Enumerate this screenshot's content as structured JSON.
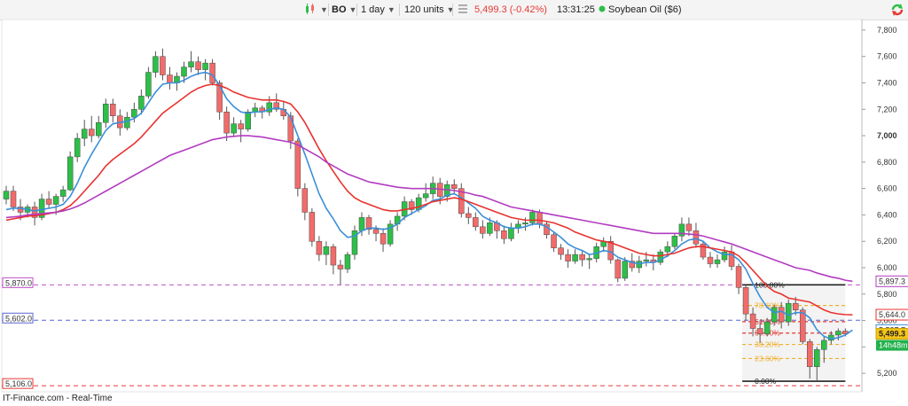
{
  "toolbar": {
    "symbol": "BO",
    "interval": "1 day",
    "units": "120 units",
    "last_price": "5,499.3",
    "change": "(-0.42%)",
    "time": "13:31:25",
    "instrument": "Soybean Oil ($6)"
  },
  "footer": {
    "text": "IT-Finance.com - Real-Time"
  },
  "colors": {
    "bull": "#2dbf47",
    "bear": "#f26b6b",
    "ma_fast": "#3a8fd9",
    "ma_mid": "#e8322e",
    "ma_slow": "#b23cc0",
    "hline_magenta": "#c050c8",
    "hline_blue": "#5a66d0",
    "hline_red": "#e53935"
  },
  "chart_data": {
    "type": "candlestick",
    "title": "",
    "xlabel": "",
    "ylabel": "",
    "ylim": [
      5060,
      7880
    ],
    "y_ticks": [
      5200,
      5400,
      5600,
      5800,
      6000,
      6200,
      6400,
      6600,
      6800,
      7000,
      7200,
      7400,
      7600,
      7800
    ],
    "y_tick_labels": [
      "5,200",
      "5,400",
      "5,600",
      "5,800",
      "6,000",
      "6,200",
      "6,400",
      "6,600",
      "6,800",
      "7,000",
      "7,200",
      "7,400",
      "7,600",
      "7,800"
    ],
    "ohlc": [
      [
        6520,
        6620,
        6480,
        6580
      ],
      [
        6580,
        6620,
        6430,
        6460
      ],
      [
        6460,
        6520,
        6360,
        6420
      ],
      [
        6420,
        6480,
        6380,
        6460
      ],
      [
        6460,
        6500,
        6320,
        6380
      ],
      [
        6380,
        6560,
        6360,
        6520
      ],
      [
        6520,
        6580,
        6450,
        6480
      ],
      [
        6480,
        6560,
        6400,
        6540
      ],
      [
        6540,
        6620,
        6500,
        6590
      ],
      [
        6590,
        6880,
        6580,
        6840
      ],
      [
        6840,
        7020,
        6800,
        6980
      ],
      [
        6980,
        7120,
        6920,
        7050
      ],
      [
        7050,
        7150,
        6950,
        7000
      ],
      [
        7000,
        7150,
        6980,
        7100
      ],
      [
        7100,
        7280,
        7060,
        7240
      ],
      [
        7240,
        7280,
        7100,
        7150
      ],
      [
        7150,
        7200,
        7000,
        7060
      ],
      [
        7060,
        7180,
        7040,
        7140
      ],
      [
        7140,
        7250,
        7100,
        7200
      ],
      [
        7200,
        7350,
        7160,
        7300
      ],
      [
        7300,
        7520,
        7280,
        7480
      ],
      [
        7480,
        7640,
        7440,
        7600
      ],
      [
        7600,
        7660,
        7420,
        7460
      ],
      [
        7460,
        7520,
        7350,
        7400
      ],
      [
        7400,
        7480,
        7340,
        7450
      ],
      [
        7450,
        7560,
        7400,
        7520
      ],
      [
        7520,
        7640,
        7480,
        7560
      ],
      [
        7560,
        7600,
        7460,
        7500
      ],
      [
        7500,
        7580,
        7420,
        7550
      ],
      [
        7550,
        7580,
        7380,
        7400
      ],
      [
        7400,
        7420,
        7120,
        7180
      ],
      [
        7180,
        7220,
        6960,
        7020
      ],
      [
        7020,
        7140,
        6990,
        7090
      ],
      [
        7090,
        7120,
        6950,
        7050
      ],
      [
        7050,
        7200,
        7030,
        7180
      ],
      [
        7180,
        7250,
        7140,
        7210
      ],
      [
        7210,
        7230,
        7130,
        7180
      ],
      [
        7180,
        7300,
        7150,
        7250
      ],
      [
        7250,
        7320,
        7180,
        7200
      ],
      [
        7200,
        7260,
        7120,
        7150
      ],
      [
        7150,
        7180,
        6900,
        6960
      ],
      [
        6960,
        6980,
        6540,
        6600
      ],
      [
        6600,
        6640,
        6360,
        6420
      ],
      [
        6420,
        6450,
        6160,
        6200
      ],
      [
        6200,
        6240,
        6050,
        6100
      ],
      [
        6100,
        6200,
        6020,
        6160
      ],
      [
        6160,
        6180,
        5950,
        6020
      ],
      [
        6020,
        6060,
        5870,
        5990
      ],
      [
        5990,
        6120,
        5960,
        6100
      ],
      [
        6100,
        6320,
        6060,
        6280
      ],
      [
        6280,
        6420,
        6240,
        6380
      ],
      [
        6380,
        6400,
        6250,
        6290
      ],
      [
        6290,
        6320,
        6200,
        6260
      ],
      [
        6260,
        6300,
        6120,
        6180
      ],
      [
        6180,
        6360,
        6160,
        6330
      ],
      [
        6330,
        6420,
        6280,
        6390
      ],
      [
        6390,
        6540,
        6360,
        6500
      ],
      [
        6500,
        6520,
        6400,
        6440
      ],
      [
        6440,
        6560,
        6420,
        6530
      ],
      [
        6530,
        6640,
        6500,
        6560
      ],
      [
        6560,
        6690,
        6520,
        6640
      ],
      [
        6640,
        6680,
        6480,
        6540
      ],
      [
        6540,
        6660,
        6500,
        6630
      ],
      [
        6630,
        6670,
        6560,
        6600
      ],
      [
        6600,
        6640,
        6380,
        6410
      ],
      [
        6410,
        6460,
        6330,
        6380
      ],
      [
        6380,
        6420,
        6280,
        6310
      ],
      [
        6310,
        6360,
        6220,
        6260
      ],
      [
        6260,
        6380,
        6240,
        6340
      ],
      [
        6340,
        6360,
        6220,
        6280
      ],
      [
        6280,
        6320,
        6180,
        6220
      ],
      [
        6220,
        6340,
        6200,
        6300
      ],
      [
        6300,
        6360,
        6260,
        6330
      ],
      [
        6330,
        6380,
        6280,
        6340
      ],
      [
        6340,
        6440,
        6320,
        6420
      ],
      [
        6420,
        6440,
        6300,
        6330
      ],
      [
        6330,
        6350,
        6220,
        6250
      ],
      [
        6250,
        6270,
        6120,
        6150
      ],
      [
        6150,
        6180,
        6060,
        6100
      ],
      [
        6100,
        6140,
        6000,
        6050
      ],
      [
        6050,
        6140,
        6030,
        6100
      ],
      [
        6100,
        6130,
        6010,
        6060
      ],
      [
        6060,
        6100,
        5990,
        6070
      ],
      [
        6070,
        6190,
        6040,
        6160
      ],
      [
        6160,
        6230,
        6120,
        6200
      ],
      [
        6200,
        6240,
        6030,
        6060
      ],
      [
        6060,
        6070,
        5890,
        5920
      ],
      [
        5920,
        6080,
        5900,
        6050
      ],
      [
        6050,
        6110,
        5970,
        6000
      ],
      [
        6000,
        6090,
        5960,
        6050
      ],
      [
        6050,
        6120,
        6010,
        6060
      ],
      [
        6060,
        6100,
        5980,
        6040
      ],
      [
        6040,
        6140,
        6020,
        6120
      ],
      [
        6120,
        6200,
        6080,
        6160
      ],
      [
        6160,
        6260,
        6140,
        6240
      ],
      [
        6240,
        6380,
        6200,
        6330
      ],
      [
        6330,
        6380,
        6240,
        6280
      ],
      [
        6280,
        6340,
        6150,
        6180
      ],
      [
        6180,
        6200,
        6060,
        6080
      ],
      [
        6080,
        6120,
        6000,
        6030
      ],
      [
        6030,
        6100,
        6000,
        6060
      ],
      [
        6060,
        6160,
        6040,
        6120
      ],
      [
        6120,
        6170,
        5980,
        6010
      ],
      [
        6010,
        6030,
        5800,
        5850
      ],
      [
        5850,
        5870,
        5600,
        5650
      ],
      [
        5650,
        5700,
        5480,
        5540
      ],
      [
        5540,
        5600,
        5430,
        5500
      ],
      [
        5500,
        5620,
        5480,
        5590
      ],
      [
        5590,
        5720,
        5560,
        5700
      ],
      [
        5700,
        5740,
        5540,
        5590
      ],
      [
        5590,
        5760,
        5560,
        5730
      ],
      [
        5730,
        5780,
        5640,
        5680
      ],
      [
        5680,
        5700,
        5420,
        5440
      ],
      [
        5440,
        5460,
        5160,
        5250
      ],
      [
        5250,
        5400,
        5140,
        5380
      ],
      [
        5380,
        5480,
        5280,
        5450
      ],
      [
        5450,
        5520,
        5420,
        5490
      ],
      [
        5490,
        5540,
        5450,
        5520
      ],
      [
        5520,
        5540,
        5480,
        5499.3
      ]
    ],
    "moving_averages": [
      {
        "color_key": "ma_fast",
        "last_value": 5527.7,
        "values": [
          6440,
          6450,
          6450,
          6440,
          6430,
          6440,
          6450,
          6460,
          6480,
          6540,
          6640,
          6760,
          6860,
          6950,
          7040,
          7090,
          7100,
          7110,
          7130,
          7170,
          7250,
          7330,
          7390,
          7400,
          7400,
          7420,
          7450,
          7470,
          7480,
          7460,
          7380,
          7280,
          7220,
          7180,
          7170,
          7180,
          7180,
          7200,
          7210,
          7200,
          7140,
          7000,
          6860,
          6710,
          6560,
          6450,
          6370,
          6280,
          6230,
          6240,
          6280,
          6300,
          6300,
          6290,
          6300,
          6330,
          6380,
          6410,
          6440,
          6470,
          6510,
          6520,
          6550,
          6560,
          6530,
          6490,
          6450,
          6390,
          6360,
          6340,
          6310,
          6300,
          6300,
          6310,
          6330,
          6330,
          6310,
          6270,
          6230,
          6180,
          6150,
          6130,
          6100,
          6110,
          6130,
          6120,
          6080,
          6060,
          6040,
          6030,
          6040,
          6040,
          6060,
          6090,
          6130,
          6180,
          6210,
          6220,
          6200,
          6150,
          6120,
          6100,
          6100,
          6060,
          5990,
          5880,
          5780,
          5700,
          5660,
          5670,
          5640,
          5660,
          5660,
          5620,
          5530,
          5480,
          5460,
          5470,
          5490,
          5527.7
        ]
      },
      {
        "color_key": "ma_mid",
        "last_value": 5644.0,
        "values": [
          6360,
          6370,
          6380,
          6390,
          6395,
          6400,
          6410,
          6420,
          6440,
          6470,
          6520,
          6580,
          6640,
          6700,
          6770,
          6820,
          6860,
          6900,
          6940,
          6990,
          7050,
          7110,
          7170,
          7210,
          7250,
          7290,
          7330,
          7360,
          7380,
          7390,
          7380,
          7360,
          7330,
          7310,
          7290,
          7280,
          7270,
          7270,
          7270,
          7260,
          7240,
          7180,
          7100,
          7000,
          6900,
          6810,
          6730,
          6650,
          6580,
          6530,
          6500,
          6480,
          6460,
          6440,
          6430,
          6430,
          6440,
          6450,
          6460,
          6480,
          6500,
          6510,
          6520,
          6530,
          6520,
          6500,
          6480,
          6460,
          6440,
          6420,
          6400,
          6380,
          6370,
          6360,
          6360,
          6360,
          6350,
          6340,
          6320,
          6300,
          6270,
          6250,
          6230,
          6210,
          6200,
          6190,
          6170,
          6150,
          6130,
          6110,
          6100,
          6090,
          6090,
          6100,
          6110,
          6130,
          6150,
          6160,
          6160,
          6150,
          6140,
          6130,
          6120,
          6090,
          6040,
          5980,
          5920,
          5860,
          5820,
          5800,
          5770,
          5760,
          5750,
          5740,
          5710,
          5680,
          5660,
          5650,
          5645,
          5644
        ]
      },
      {
        "color_key": "ma_slow",
        "last_value": 5897.3,
        "values": [
          6380,
          6385,
          6390,
          6400,
          6405,
          6410,
          6415,
          6420,
          6430,
          6445,
          6465,
          6490,
          6520,
          6550,
          6580,
          6610,
          6640,
          6670,
          6700,
          6730,
          6760,
          6790,
          6820,
          6850,
          6870,
          6890,
          6910,
          6930,
          6950,
          6970,
          6980,
          6990,
          6995,
          7000,
          7000,
          6995,
          6990,
          6980,
          6970,
          6960,
          6950,
          6930,
          6900,
          6870,
          6840,
          6800,
          6770,
          6740,
          6710,
          6690,
          6670,
          6650,
          6640,
          6630,
          6620,
          6610,
          6605,
          6600,
          6600,
          6600,
          6600,
          6595,
          6590,
          6585,
          6575,
          6565,
          6550,
          6540,
          6520,
          6500,
          6480,
          6460,
          6450,
          6440,
          6430,
          6420,
          6410,
          6400,
          6390,
          6380,
          6370,
          6360,
          6350,
          6340,
          6330,
          6320,
          6310,
          6300,
          6290,
          6280,
          6270,
          6260,
          6260,
          6260,
          6260,
          6260,
          6255,
          6250,
          6240,
          6225,
          6210,
          6195,
          6180,
          6160,
          6140,
          6120,
          6100,
          6080,
          6060,
          6040,
          6020,
          6000,
          5990,
          5980,
          5960,
          5945,
          5930,
          5920,
          5905,
          5897.3
        ]
      }
    ],
    "horizontal_lines": [
      {
        "value": 5870.0,
        "label": "5,870.0",
        "color_key": "hline_magenta"
      },
      {
        "value": 5602.0,
        "label": "5,602.0",
        "color_key": "hline_blue"
      },
      {
        "value": 5106.0,
        "label": "5,106.0",
        "color_key": "hline_red"
      }
    ],
    "price_tags": [
      {
        "value": 5897.3,
        "label": "5,897.3",
        "color_key": "ma_slow"
      },
      {
        "value": 5644.0,
        "label": "5,644.0",
        "color_key": "ma_mid"
      },
      {
        "value": 5527.7,
        "label": "5,527.7",
        "color_key": "ma_fast"
      }
    ],
    "current_price": {
      "value": 5499.3,
      "label": "5,499.3",
      "countdown": "14h48m"
    },
    "fibonacci": {
      "from_candle": 105,
      "to_candle": 117,
      "high": 5870,
      "low": 5140,
      "levels": [
        {
          "ratio": 1.0,
          "label": "100.00%",
          "color": "#222222"
        },
        {
          "ratio": 0.786,
          "label": "78.60%",
          "color": "#f0b030"
        },
        {
          "ratio": 0.618,
          "label": "61.80%",
          "color": "#e53935"
        },
        {
          "ratio": 0.5,
          "label": "50.00%",
          "color": "#e53935"
        },
        {
          "ratio": 0.382,
          "label": "38.20%",
          "color": "#f0b030"
        },
        {
          "ratio": 0.236,
          "label": "23.60%",
          "color": "#f0b030"
        },
        {
          "ratio": 0.0,
          "label": "0.00%",
          "color": "#222222"
        }
      ]
    }
  }
}
